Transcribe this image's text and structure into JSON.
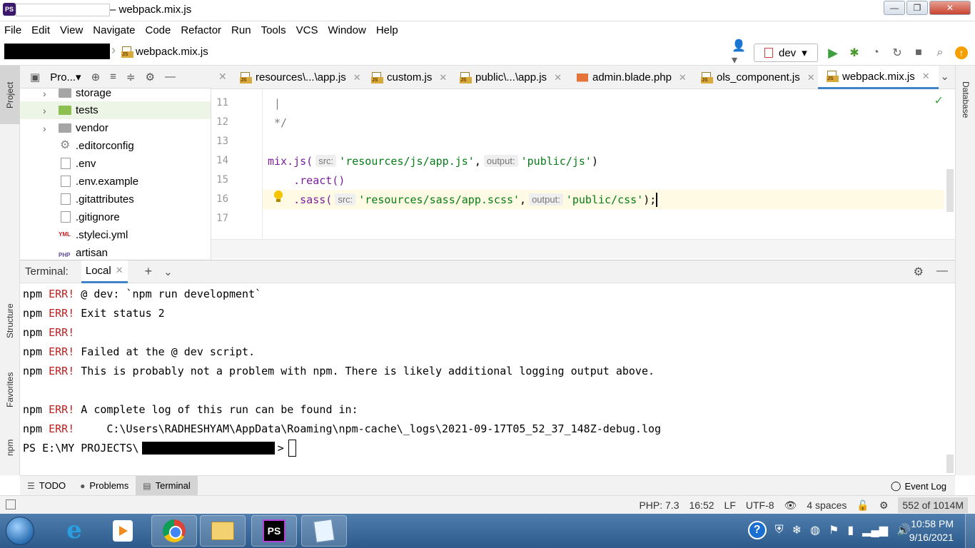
{
  "window": {
    "title": "– webpack.mix.js",
    "controls": {
      "minimize": "—",
      "maximize": "❐",
      "close": "✕"
    }
  },
  "menu": [
    "File",
    "Edit",
    "View",
    "Navigate",
    "Code",
    "Refactor",
    "Run",
    "Tools",
    "VCS",
    "Window",
    "Help"
  ],
  "navbar": {
    "file": "webpack.mix.js",
    "run_config": "dev"
  },
  "left_strip": {
    "project": "Project",
    "structure": "Structure",
    "favorites": "Favorites",
    "npm": "npm"
  },
  "right_strip": {
    "database": "Database"
  },
  "project_panel": {
    "title": "Pro...▾",
    "items": [
      {
        "label": "storage",
        "type": "folder"
      },
      {
        "label": "tests",
        "type": "folder-green"
      },
      {
        "label": "vendor",
        "type": "folder"
      },
      {
        "label": ".editorconfig",
        "type": "gear"
      },
      {
        "label": ".env",
        "type": "file"
      },
      {
        "label": ".env.example",
        "type": "file"
      },
      {
        "label": ".gitattributes",
        "type": "file"
      },
      {
        "label": ".gitignore",
        "type": "ignore"
      },
      {
        "label": ".styleci.yml",
        "type": "yml"
      },
      {
        "label": "artisan",
        "type": "php"
      }
    ]
  },
  "editor_tabs": [
    {
      "label": "resources\\...\\app.js",
      "icon": "js"
    },
    {
      "label": "custom.js",
      "icon": "js"
    },
    {
      "label": "public\\...\\app.js",
      "icon": "js"
    },
    {
      "label": "admin.blade.php",
      "icon": "html"
    },
    {
      "label": "ols_component.js",
      "icon": "js"
    },
    {
      "label": "webpack.mix.js",
      "icon": "js",
      "active": true
    }
  ],
  "editor": {
    "line_numbers": [
      "11",
      "12",
      "13",
      "14",
      "15",
      "16",
      "17"
    ],
    "lines": {
      "l11": "|",
      "l12": "*/",
      "l14_fn": "mix.js(",
      "l14_hint1": "src:",
      "l14_str1": "'resources/js/app.js'",
      "l14_sep": ",",
      "l14_hint2": "output:",
      "l14_str2": "'public/js'",
      "l14_end": ")",
      "l15": "    .react()",
      "l16_fn": "    .sass(",
      "l16_hint1": "src:",
      "l16_str1": "'resources/sass/app.scss'",
      "l16_sep": ",",
      "l16_hint2": "output:",
      "l16_str2": "'public/css'",
      "l16_end": ");"
    }
  },
  "terminal": {
    "label": "Terminal:",
    "tab": "Local",
    "prefix": "npm ",
    "err": "ERR!",
    "lines": [
      " @ dev: `npm run development`",
      " Exit status 2",
      "",
      " Failed at the @ dev script.",
      " This is probably not a problem with npm. There is likely additional logging output above.",
      " A complete log of this run can be found in:",
      "     C:\\Users\\RADHESHYAM\\AppData\\Roaming\\npm-cache\\_logs\\2021-09-17T05_52_37_148Z-debug.log"
    ],
    "prompt_start": "PS E:\\MY PROJECTS\\",
    "prompt_end": ">"
  },
  "bottom_tabs": {
    "todo": "TODO",
    "problems": "Problems",
    "terminal": "Terminal",
    "event_log": "Event Log"
  },
  "status": {
    "php": "PHP: 7.3",
    "position": "16:52",
    "line_sep": "LF",
    "encoding": "UTF-8",
    "indent": "4 spaces",
    "memory": "552 of 1014M"
  },
  "taskbar": {
    "time": "10:58 PM",
    "date": "9/16/2021",
    "phpstorm_label": "PS"
  },
  "colors": {
    "accent": "#4083c9",
    "error": "#c02020",
    "string": "#067d17",
    "function": "#7a1e9e"
  }
}
